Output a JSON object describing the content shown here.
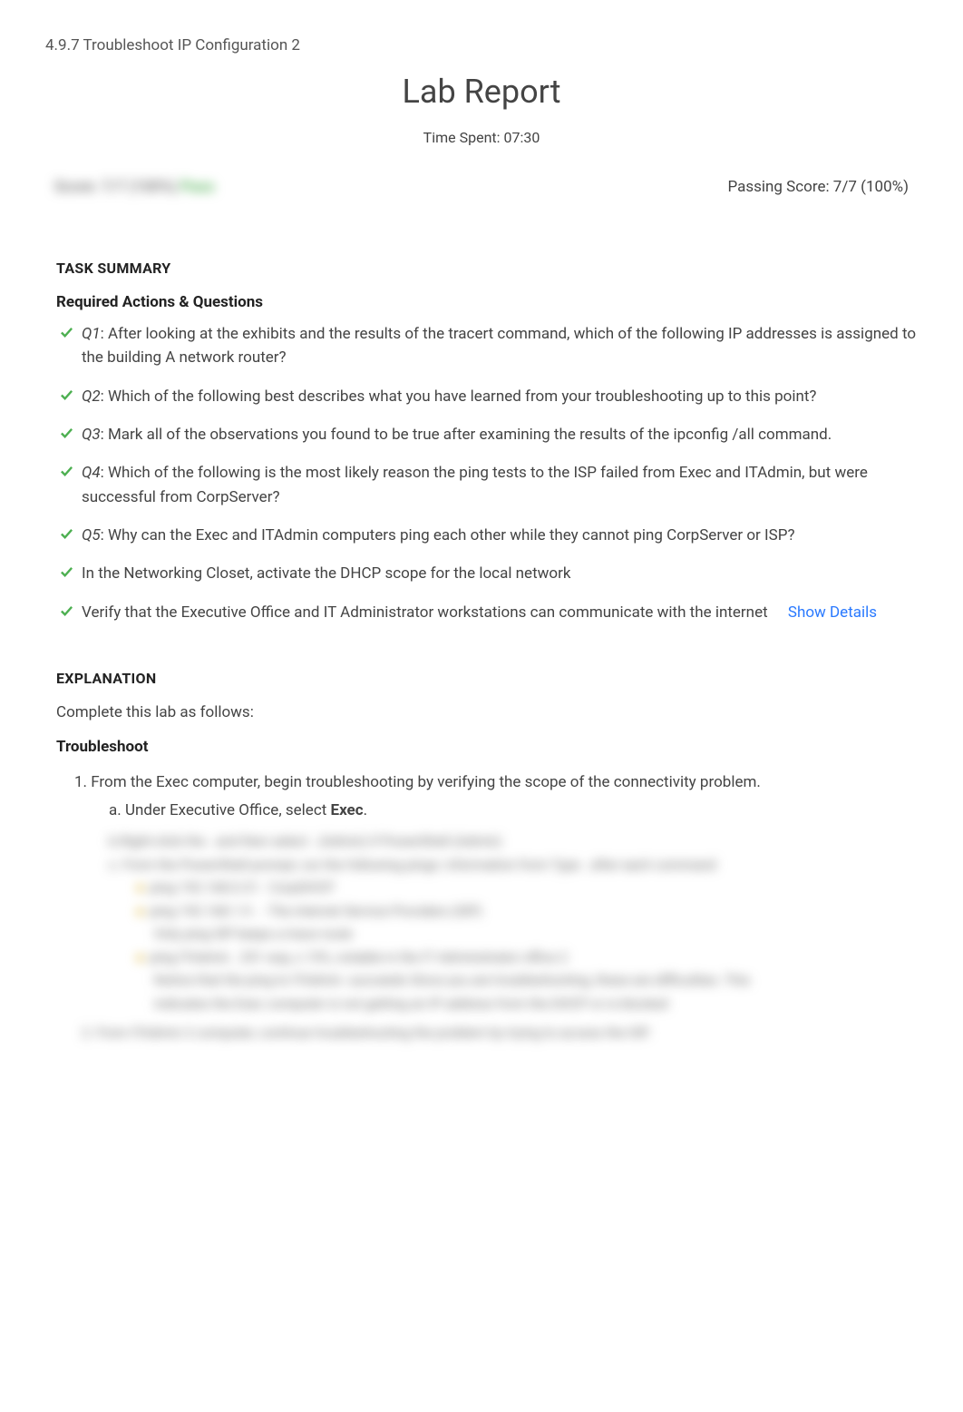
{
  "breadcrumb": "4.9.7 Troubleshoot IP Configuration 2",
  "report_title": "Lab Report",
  "time_spent_label": "Time Spent: 07:30",
  "score_left_text": "Score: 7/7 (100%)",
  "score_left_pass": "Pass",
  "passing_score": "Passing Score: 7/7 (100%)",
  "task_summary_heading": "TASK SUMMARY",
  "required_actions_heading": "Required Actions & Questions",
  "questions": [
    {
      "label": "Q1",
      "text": ":  After looking at the exhibits and the results of the tracert command, which of the following IP addresses is assigned to the building A network router?"
    },
    {
      "label": "Q2",
      "text": ":  Which of the following best describes what you have learned from your troubleshooting up to this point?"
    },
    {
      "label": "Q3",
      "text": ":  Mark all of the observations you found to be true after examining the results of the ipconfig /all command."
    },
    {
      "label": "Q4",
      "text": ":  Which of the following is the most likely reason the ping tests to the ISP failed from Exec and ITAdmin, but were successful from CorpServer?"
    },
    {
      "label": "Q5",
      "text": ":  Why can the Exec and ITAdmin computers ping each other while they cannot ping CorpServer or ISP?"
    }
  ],
  "tasks": [
    {
      "text": "In the Networking Closet, activate the DHCP scope for the local network",
      "has_details": false
    },
    {
      "text": "Verify that the Executive Office and IT Administrator workstations can communicate with the internet",
      "has_details": true
    }
  ],
  "show_details_label": "Show Details",
  "explanation_heading": "EXPLANATION",
  "explanation_intro": "Complete this lab as follows:",
  "troubleshoot_heading": "Troubleshoot",
  "step1_text": "1. From the Exec computer, begin troubleshooting by verifying the scope of the connectivity problem.",
  "step1a_prefix": "a. Under Executive Office, select ",
  "step1a_bold": "Exec",
  "step1a_suffix": ".",
  "blurred_lines": [
    "b.Right-click  the  . and then select  . (Admin) if PowerShell (Admin)",
    "c. From the PowerShell prompt, run the following pings: information from                     Type  . after each command",
    "ping 192.168.0.31  - CorpDHCP",
    "ping 192.168.1.9 . - The internet Service Providers (ISP)",
    "Only ping ISP keeps a trace route",
    "ping ITAdmin . 251 way, x 15%, notable in the IT Administrator office 2",
    "Notice that the ping to ITAdmin .succeeds Since you are troubleshooting, these are difficulties. This",
    "indicates the Exec computer is not getting an IP address from the DHCP or is blocked"
  ],
  "blurred_final": "2. From ITAdmin 2 computer, continue troubleshooting the problem by trying to access the ISP."
}
